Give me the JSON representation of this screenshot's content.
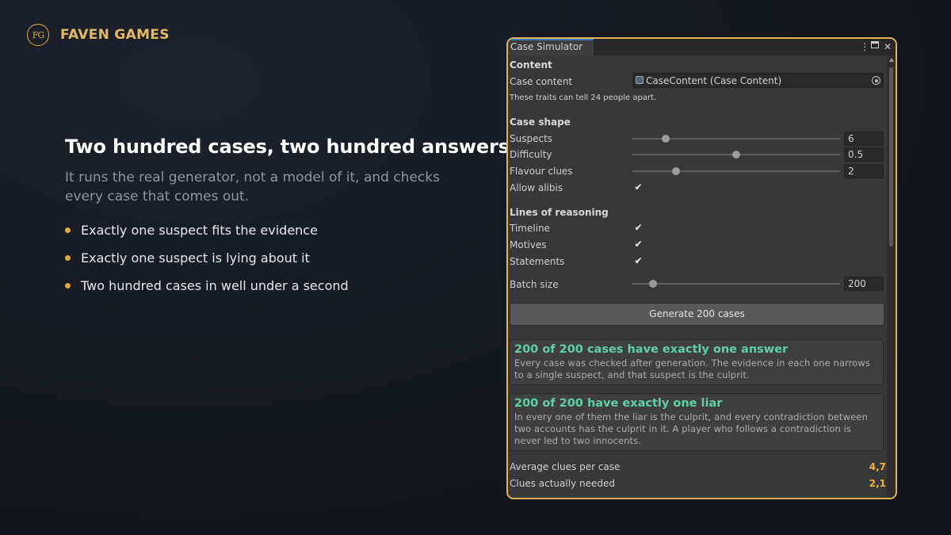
{
  "brand": {
    "logo_text": "FG",
    "name": "FAVEN GAMES"
  },
  "slide": {
    "headline": "Two hundred cases, two hundred answers",
    "subtitle": "It runs the real generator, not a model of it, and checks every case that comes out.",
    "bullets": [
      "Exactly one suspect fits the evidence",
      "Exactly one suspect is lying about it",
      "Two hundred cases in well under a second"
    ]
  },
  "colors": {
    "accent": "#e0b35a",
    "success_text": "#5fd0a6",
    "stat_value": "#f0b43c",
    "bullet_dot": "#e0a93a"
  },
  "window": {
    "tab_title": "Case Simulator",
    "icons": [
      "more-vertical-icon",
      "maximize-icon",
      "close-icon"
    ],
    "content_header": "Content",
    "case_content": {
      "label": "Case content",
      "value": "CaseContent (Case Content)"
    },
    "traits_note": "These traits can tell 24 people apart.",
    "case_shape": {
      "header": "Case shape",
      "suspects": {
        "label": "Suspects",
        "value": "6",
        "fraction": 0.16
      },
      "difficulty": {
        "label": "Difficulty",
        "value": "0.5",
        "fraction": 0.5
      },
      "flavour_clues": {
        "label": "Flavour clues",
        "value": "2",
        "fraction": 0.21
      },
      "allow_alibis": {
        "label": "Allow alibis",
        "checked": true
      }
    },
    "lines_of_reasoning": {
      "header": "Lines of reasoning",
      "timeline": {
        "label": "Timeline",
        "checked": true
      },
      "motives": {
        "label": "Motives",
        "checked": true
      },
      "statements": {
        "label": "Statements",
        "checked": true
      }
    },
    "batch_size": {
      "label": "Batch size",
      "value": "200",
      "fraction": 0.1
    },
    "generate_button": "Generate 200 cases",
    "results": [
      {
        "title": "200 of 200 cases have exactly one answer",
        "body": "Every case was checked after generation. The evidence in each one narrows to a single suspect, and that suspect is the culprit."
      },
      {
        "title": "200 of 200 have exactly one liar",
        "body": "In every one of them the liar is the culprit, and every contradiction between two accounts has the culprit in it. A player who follows a contradiction is never led to two innocents."
      }
    ],
    "stats": [
      {
        "label": "Average clues per case",
        "value": "4,7"
      },
      {
        "label": "Clues actually needed",
        "value": "2,1"
      }
    ]
  }
}
